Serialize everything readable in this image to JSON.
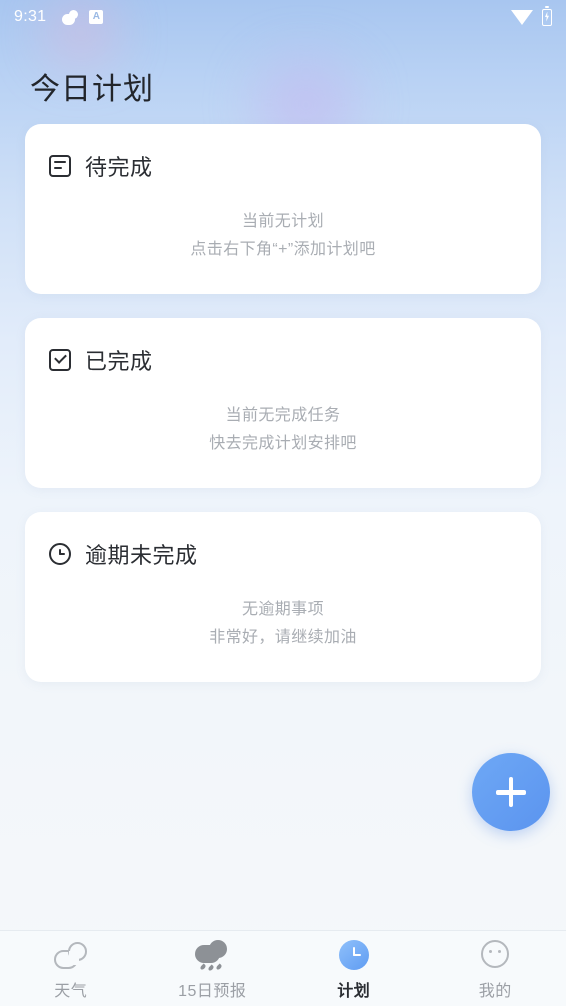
{
  "status_bar": {
    "time": "9:31",
    "app_badge_letter": "A",
    "icons": [
      "weather-cloud-icon",
      "app-badge-icon",
      "wifi-icon",
      "battery-charging-icon"
    ]
  },
  "header": {
    "title": "今日计划"
  },
  "cards": [
    {
      "icon": "document-list-icon",
      "title": "待完成",
      "empty_primary": "当前无计划",
      "empty_secondary": "点击右下角“+”添加计划吧"
    },
    {
      "icon": "checkbox-checked-icon",
      "title": "已完成",
      "empty_primary": "当前无完成任务",
      "empty_secondary": "快去完成计划安排吧"
    },
    {
      "icon": "clock-outline-icon",
      "title": "逾期未完成",
      "empty_primary": "无逾期事项",
      "empty_secondary": "非常好，请继续加油"
    }
  ],
  "fab": {
    "icon": "plus-icon",
    "label": "+",
    "color": "#5b94ef"
  },
  "bottom_nav": {
    "active_index": 2,
    "items": [
      {
        "label": "天气",
        "icon": "cloud-outline-icon"
      },
      {
        "label": "15日预报",
        "icon": "rain-cloud-icon"
      },
      {
        "label": "计划",
        "icon": "clock-filled-icon"
      },
      {
        "label": "我的",
        "icon": "face-outline-icon"
      }
    ]
  },
  "colors": {
    "accent": "#5b94ef",
    "background_top": "#a8c6f0",
    "background_bottom": "#f5f8fb",
    "card": "#ffffff",
    "muted_text": "#a9adb3",
    "title_text": "#2b2e33"
  }
}
